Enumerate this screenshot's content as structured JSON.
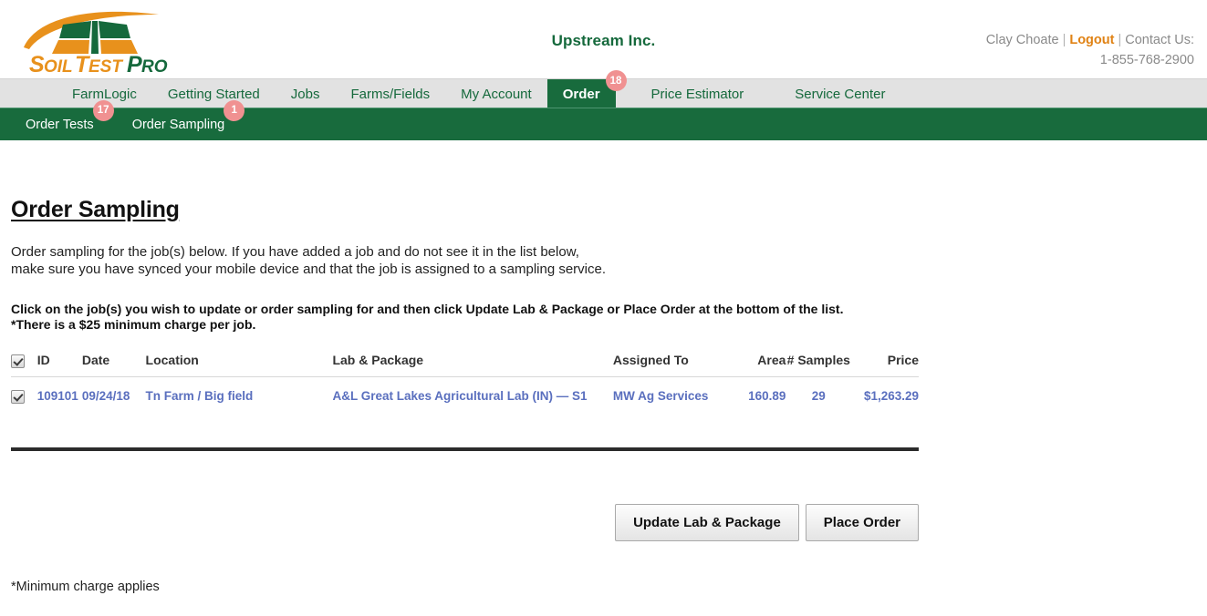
{
  "header": {
    "logo": {
      "name": "soiltestpro-logo",
      "text_soil": "Soil",
      "text_test": "Test",
      "text_pro": "Pro",
      "color_orange": "#e8911c",
      "color_green": "#15693c"
    },
    "company_name": "Upstream Inc.",
    "account": {
      "user_name": "Clay Choate",
      "separator": "|",
      "logout_label": "Logout",
      "contact_label": "Contact Us:",
      "phone": "1-855-768-2900"
    }
  },
  "nav_main": {
    "items": [
      {
        "label": "FarmLogic",
        "active": false,
        "badge": ""
      },
      {
        "label": "Getting Started",
        "active": false,
        "badge": ""
      },
      {
        "label": "Jobs",
        "active": false,
        "badge": ""
      },
      {
        "label": "Farms/Fields",
        "active": false,
        "badge": ""
      },
      {
        "label": "My Account",
        "active": false,
        "badge": ""
      },
      {
        "label": "Order",
        "active": true,
        "badge": "18"
      },
      {
        "label": "Price Estimator",
        "active": false,
        "badge": ""
      },
      {
        "label": "Service Center",
        "active": false,
        "badge": ""
      }
    ]
  },
  "nav_sub": {
    "items": [
      {
        "label": "Order Tests",
        "badge": "17"
      },
      {
        "label": "Order Sampling",
        "badge": "1"
      }
    ]
  },
  "main": {
    "page_title": "Order Sampling",
    "intro_line1": "Order sampling for the job(s) below. If you have added a job and do not see it in the list below,",
    "intro_line2": "make sure you have synced your mobile device and that the job is assigned to a sampling service.",
    "instruction_line1": "Click on the job(s) you wish to update or order sampling for and then click Update Lab & Package or Place Order at the bottom of the list.",
    "instruction_line2": "*There is a $25 minimum charge per job.",
    "table": {
      "headers": {
        "select_all": "",
        "id": "ID",
        "date": "Date",
        "location": "Location",
        "lab_package": "Lab & Package",
        "assigned_to": "Assigned To",
        "area": "Area",
        "samples": "# Samples",
        "price": "Price"
      },
      "rows": [
        {
          "checked": true,
          "id": "109101",
          "date": "09/24/18",
          "location": "Tn Farm / Big field",
          "lab_package": "A&L Great Lakes Agricultural Lab (IN) — S1",
          "assigned_to": "MW Ag Services",
          "area": "160.89",
          "samples": "29",
          "price": "$1,263.29"
        }
      ]
    },
    "buttons": {
      "update_lab_package": "Update Lab & Package",
      "place_order": "Place Order"
    },
    "footnote": "*Minimum charge applies"
  }
}
